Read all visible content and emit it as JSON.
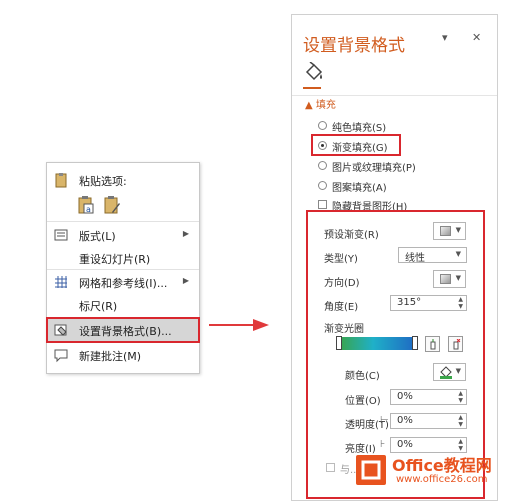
{
  "context_menu": {
    "paste_heading": "粘贴选项:",
    "items": [
      {
        "label": "版式(L)",
        "icon": "layout-icon",
        "submenu": true
      },
      {
        "label": "重设幻灯片(R)",
        "icon": "",
        "submenu": false
      },
      {
        "label": "网格和参考线(I)...",
        "icon": "grid-icon",
        "submenu": true
      },
      {
        "label": "标尺(R)",
        "icon": "",
        "submenu": false
      },
      {
        "label": "设置背景格式(B)...",
        "icon": "format-background-icon",
        "submenu": false
      },
      {
        "label": "新建批注(M)",
        "icon": "new-comment-icon",
        "submenu": false
      }
    ]
  },
  "pane": {
    "title": "设置背景格式",
    "dropdown_glyph": "▾",
    "close_glyph": "✕",
    "section": "▲ 填充",
    "options": {
      "solid": "纯色填充(S)",
      "gradient": "渐变填充(G)",
      "picture": "图片或纹理填充(P)",
      "pattern": "图案填充(A)",
      "hide_graphics": "隐藏背景图形(H)"
    },
    "selected_fill": "gradient",
    "preset_label": "预设渐变(R)",
    "type_label": "类型(Y)",
    "type_value": "线性",
    "direction_label": "方向(D)",
    "angle_label": "角度(E)",
    "angle_value": "315°",
    "stops_label": "渐变光圈",
    "color_label": "颜色(C)",
    "position_label": "位置(O)",
    "position_value": "0%",
    "transparency_label": "透明度(T)",
    "transparency_value": "0%",
    "brightness_label": "亮度(I)",
    "brightness_value": "0%",
    "partial_label": "与..."
  },
  "watermark": {
    "title": "Office教程网",
    "url": "www.office26.com"
  },
  "colors": {
    "accent": "#d15c1f",
    "highlight_border": "#d9272e",
    "arrow": "#e0393b"
  }
}
